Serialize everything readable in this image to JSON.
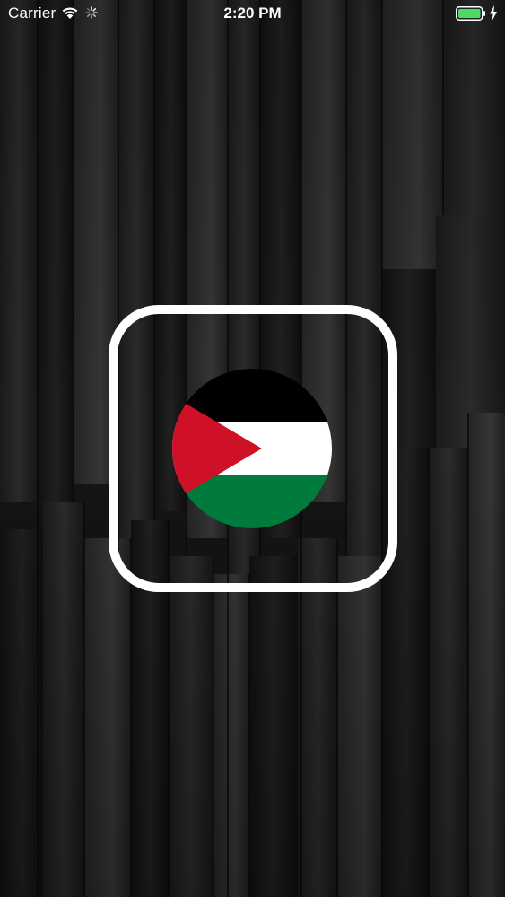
{
  "status_bar": {
    "carrier": "Carrier",
    "time": "2:20 PM",
    "icons": {
      "wifi": "wifi-icon",
      "activity": "activity-spinner-icon",
      "battery": "battery-full-icon",
      "charging": "charging-bolt-icon"
    },
    "battery_color": "#4cd964"
  },
  "splash": {
    "logo": "palestine-flag-icon",
    "frame_color": "#ffffff",
    "flag_colors": {
      "black": "#000000",
      "white": "#ffffff",
      "green": "#007a3d",
      "red": "#ce1126"
    }
  }
}
